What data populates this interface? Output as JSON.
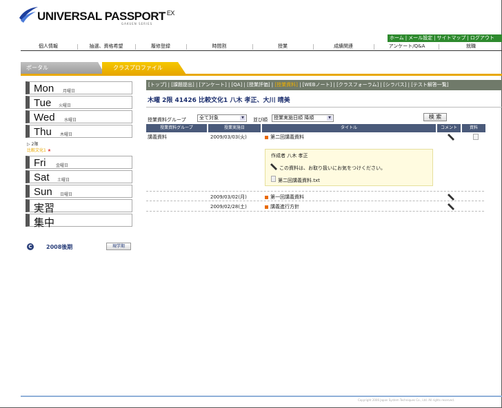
{
  "header": {
    "logo_text": "UNIVERSAL PASSPORT",
    "logo_suffix": "EX",
    "logo_sub": "GAKUEN SERIES",
    "util_links": [
      "ホーム",
      "|",
      "メール設定",
      "|",
      "サイトマップ",
      "|",
      "ログアウト"
    ]
  },
  "topnav": {
    "items": [
      "個人情報",
      "抽選、資格希望",
      "履修登録",
      "時間割",
      "授業",
      "成績関連",
      "アンケート/Q&A",
      "就職"
    ]
  },
  "tabs": {
    "portal": "ポータル",
    "class_profile": "クラスプロファイル"
  },
  "sidebar": {
    "days": [
      {
        "en": "Mon",
        "jp": "月曜日"
      },
      {
        "en": "Tue",
        "jp": "火曜日"
      },
      {
        "en": "Wed",
        "jp": "水曜日"
      },
      {
        "en": "Thu",
        "jp": "木曜日"
      }
    ],
    "thu_period": "▷ 2限",
    "thu_course": "比較文化1",
    "thu_star": "★",
    "days2": [
      {
        "en": "Fri",
        "jp": "金曜日"
      },
      {
        "en": "Sat",
        "jp": "土曜日"
      },
      {
        "en": "Sun",
        "jp": "日曜日"
      },
      {
        "en": "実習",
        "jp": ""
      },
      {
        "en": "集中",
        "jp": ""
      }
    ],
    "term_icon": "C",
    "term_name": "2008後期",
    "term_button": "現学期"
  },
  "breadcrumb": {
    "before": "[トップ] | [課題提出] | [アンケート] | [QA] | [授業評価] | ",
    "current": "[授業資料]",
    "after": " | [WEBノート] | [クラスフォーラム] | [シラバス] | [テスト解答一覧]"
  },
  "course_title": "木曜 2限 41426 比較文化1 八木 孝正、大川 晴美",
  "filter": {
    "group_label": "授業資料グループ",
    "group_value": "全て対象",
    "sort_label": "並び順",
    "sort_value": "授業実施日順 降順",
    "search_button": "検 索"
  },
  "table": {
    "headers": [
      "授業資料グループ",
      "授業実施日",
      "タイトル",
      "コメント",
      "資料"
    ],
    "rows": [
      {
        "group": "講義資料",
        "date": "2009/03/03(火)",
        "title": "第二回講義資料"
      },
      {
        "group": "",
        "date": "2009/03/02(月)",
        "title": "第一回講義資料"
      },
      {
        "group": "",
        "date": "2009/02/28(土)",
        "title": "講義進行方針"
      }
    ],
    "popup": {
      "author": "作成者 八木 孝正",
      "message": "この資料は、お取り扱いにお気をつけください。",
      "file": "第二回講義資料.txt"
    }
  },
  "footer": {
    "copyright": "Copyright 2006 Japan System Techniques Co., Ltd. All rights reserved."
  },
  "colors": {
    "accent_yellow": "#e8a800",
    "nav_green": "#2e8a2e",
    "header_navy": "#4a5a7a",
    "title_navy": "#1c2f6e"
  }
}
